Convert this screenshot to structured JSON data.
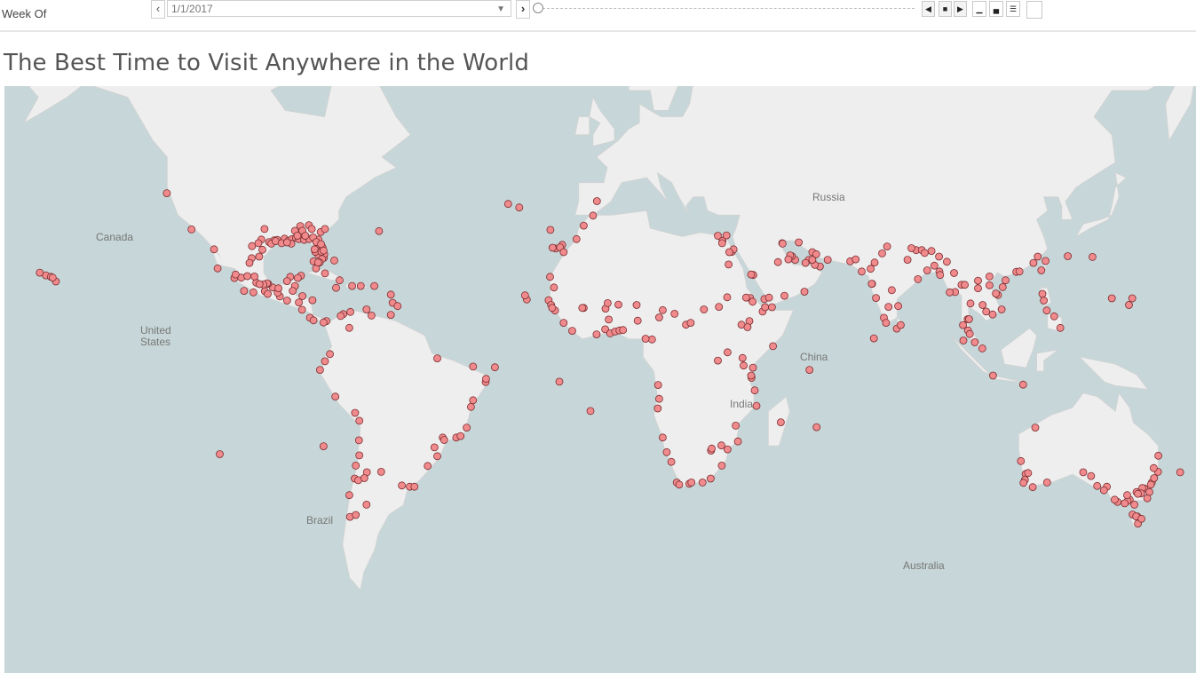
{
  "filter": {
    "label": "Week Of",
    "value": "1/1/2017",
    "prev_icon": "chevron-left-icon",
    "next_icon": "chevron-right-icon",
    "slider_position": 0
  },
  "title": "The Best Time to Visit Anywhere in the World",
  "map": {
    "ocean_color": "#c7d6d8",
    "land_color": "#eeeeee",
    "marker_color": "#f08a8c",
    "marker_stroke": "#7a2c2f",
    "labels": {
      "canada": "Canada",
      "united_states": [
        "United",
        "States"
      ],
      "brazil": "Brazil",
      "russia": "Russia",
      "china": "China",
      "india": "India",
      "australia": "Australia"
    },
    "points": [
      [
        -124.1,
        40.8
      ],
      [
        -117.2,
        32.7
      ],
      [
        -110.9,
        27.9
      ],
      [
        -109.9,
        23.1
      ],
      [
        -105.2,
        20.6
      ],
      [
        -99.9,
        16.8
      ],
      [
        -96.7,
        17.1
      ],
      [
        -95.5,
        29.7
      ],
      [
        -97.4,
        27.8
      ],
      [
        -96.8,
        32.8
      ],
      [
        -97.7,
        30.3
      ],
      [
        -98.5,
        29.4
      ],
      [
        -94.1,
        30.1
      ],
      [
        -93.2,
        30.2
      ],
      [
        -91.2,
        30.5
      ],
      [
        -90.1,
        30.0
      ],
      [
        -89.1,
        30.4
      ],
      [
        -88.0,
        30.7
      ],
      [
        -86.8,
        33.5
      ],
      [
        -87.2,
        30.4
      ],
      [
        -85.7,
        30.2
      ],
      [
        -84.3,
        30.4
      ],
      [
        -84.4,
        33.7
      ],
      [
        -82.5,
        27.9
      ],
      [
        -81.8,
        26.6
      ],
      [
        -80.2,
        25.8
      ],
      [
        -81.4,
        28.5
      ],
      [
        -81.7,
        30.3
      ],
      [
        -81.1,
        32.1
      ],
      [
        -79.9,
        32.8
      ],
      [
        -80.1,
        26.7
      ],
      [
        -82.6,
        27.3
      ],
      [
        -80.6,
        28.4
      ],
      [
        -86.6,
        21.2
      ],
      [
        -87.5,
        20.6
      ],
      [
        -88.3,
        18.5
      ],
      [
        -89.6,
        20.9
      ],
      [
        -90.5,
        14.6
      ],
      [
        -87.2,
        14.1
      ],
      [
        -86.3,
        12.1
      ],
      [
        -84.1,
        9.9
      ],
      [
        -79.5,
        9.0
      ],
      [
        -82.4,
        23.1
      ],
      [
        -79.9,
        21.8
      ],
      [
        -75.8,
        20.0
      ],
      [
        -77.3,
        25.1
      ],
      [
        -76.8,
        18.0
      ],
      [
        -72.3,
        18.5
      ],
      [
        -69.9,
        18.5
      ],
      [
        -66.1,
        18.5
      ],
      [
        -68.3,
        12.2
      ],
      [
        -64.8,
        32.3
      ],
      [
        -61.5,
        16.2
      ],
      [
        -61.0,
        14.0
      ],
      [
        -59.6,
        13.1
      ],
      [
        -61.5,
        10.7
      ],
      [
        -74.8,
        10.9
      ],
      [
        -75.5,
        10.4
      ],
      [
        -73.1,
        7.1
      ],
      [
        -66.9,
        10.5
      ],
      [
        -72.8,
        11.5
      ],
      [
        -79.9,
        -2.2
      ],
      [
        -78.5,
        -0.2
      ],
      [
        -81.3,
        -4.6
      ],
      [
        -77.0,
        -12.0
      ],
      [
        -71.5,
        -16.4
      ],
      [
        -70.3,
        -18.5
      ],
      [
        -70.4,
        -23.6
      ],
      [
        -70.3,
        -27.4
      ],
      [
        -71.3,
        -29.9
      ],
      [
        -71.6,
        -33.0
      ],
      [
        -70.6,
        -33.4
      ],
      [
        -73.1,
        -36.8
      ],
      [
        -72.9,
        -41.5
      ],
      [
        -71.3,
        -41.1
      ],
      [
        -68.3,
        -38.9
      ],
      [
        -64.2,
        -31.4
      ],
      [
        -58.4,
        -34.6
      ],
      [
        -56.2,
        -34.9
      ],
      [
        -54.9,
        -34.9
      ],
      [
        -51.2,
        -30.0
      ],
      [
        -48.5,
        -27.6
      ],
      [
        -49.3,
        -25.4
      ],
      [
        -47.0,
        -22.9
      ],
      [
        -46.6,
        -23.5
      ],
      [
        -43.2,
        -22.9
      ],
      [
        -42.0,
        -22.5
      ],
      [
        -40.3,
        -20.3
      ],
      [
        -38.5,
        -13.0
      ],
      [
        -39.1,
        -14.8
      ],
      [
        -35.0,
        -8.0
      ],
      [
        -34.9,
        -7.1
      ],
      [
        -38.5,
        -3.7
      ],
      [
        -80.3,
        -25.1
      ],
      [
        -32.4,
        -3.9
      ],
      [
        -48.5,
        -1.4
      ],
      [
        -109.3,
        -27.1
      ],
      [
        -25.6,
        37.7
      ],
      [
        -28.7,
        38.5
      ],
      [
        -16.9,
        32.6
      ],
      [
        -15.4,
        28.1
      ],
      [
        -13.6,
        29.0
      ],
      [
        -16.3,
        28.3
      ],
      [
        -14.2,
        28.4
      ],
      [
        -17.4,
        14.7
      ],
      [
        -16.7,
        13.4
      ],
      [
        -13.2,
        8.5
      ],
      [
        -15.6,
        11.9
      ],
      [
        -16.4,
        12.6
      ],
      [
        -10.8,
        6.3
      ],
      [
        -7.6,
        12.6
      ],
      [
        -4.0,
        5.3
      ],
      [
        -1.6,
        6.7
      ],
      [
        -0.2,
        5.6
      ],
      [
        1.2,
        6.1
      ],
      [
        2.4,
        6.4
      ],
      [
        3.4,
        6.5
      ],
      [
        7.5,
        9.1
      ],
      [
        -8.0,
        12.6
      ],
      [
        -1.5,
        12.4
      ],
      [
        2.1,
        13.5
      ],
      [
        -23.5,
        14.9
      ],
      [
        -24.0,
        16.0
      ],
      [
        -14.4,
        -7.9
      ],
      [
        -5.7,
        -15.9
      ],
      [
        11.5,
        3.9
      ],
      [
        9.7,
        4.1
      ],
      [
        13.2,
        -8.8
      ],
      [
        13.5,
        -12.6
      ],
      [
        13.1,
        -15.2
      ],
      [
        14.5,
        -22.9
      ],
      [
        15.6,
        -26.6
      ],
      [
        16.9,
        -29.0
      ],
      [
        18.4,
        -33.9
      ],
      [
        19.1,
        -34.4
      ],
      [
        21.9,
        -34.2
      ],
      [
        22.5,
        -33.9
      ],
      [
        25.6,
        -33.9
      ],
      [
        27.9,
        -33.0
      ],
      [
        31.0,
        -29.9
      ],
      [
        30.9,
        -24.9
      ],
      [
        28.0,
        -26.2
      ],
      [
        28.2,
        -25.7
      ],
      [
        32.6,
        -25.9
      ],
      [
        35.5,
        -23.9
      ],
      [
        34.9,
        -19.8
      ],
      [
        40.7,
        -14.5
      ],
      [
        39.3,
        -6.8
      ],
      [
        39.7,
        -4.0
      ],
      [
        39.2,
        -6.2
      ],
      [
        36.8,
        -1.3
      ],
      [
        37.1,
        -3.4
      ],
      [
        32.6,
        0.3
      ],
      [
        29.9,
        -2.0
      ],
      [
        40.2,
        -10.3
      ],
      [
        47.5,
        -18.9
      ],
      [
        57.5,
        -20.2
      ],
      [
        55.5,
        -4.6
      ],
      [
        31.2,
        30.0
      ],
      [
        31.1,
        29.4
      ],
      [
        32.3,
        31.3
      ],
      [
        29.9,
        31.2
      ],
      [
        32.9,
        24.1
      ],
      [
        33.8,
        27.3
      ],
      [
        34.3,
        27.9
      ],
      [
        32.5,
        15.5
      ],
      [
        33.1,
        27.2
      ],
      [
        38.9,
        15.3
      ],
      [
        38.7,
        9.0
      ],
      [
        42.4,
        11.6
      ],
      [
        45.3,
        2.0
      ],
      [
        43.1,
        12.8
      ],
      [
        45.0,
        12.8
      ],
      [
        42.9,
        15.0
      ],
      [
        44.2,
        15.4
      ],
      [
        48.5,
        15.9
      ],
      [
        54.1,
        17.0
      ],
      [
        58.4,
        23.6
      ],
      [
        57.0,
        24.0
      ],
      [
        55.3,
        25.3
      ],
      [
        54.4,
        24.5
      ],
      [
        56.3,
        25.3
      ],
      [
        51.5,
        25.3
      ],
      [
        50.6,
        26.2
      ],
      [
        50.1,
        26.4
      ],
      [
        49.6,
        25.4
      ],
      [
        46.7,
        24.7
      ],
      [
        39.8,
        21.4
      ],
      [
        39.2,
        21.5
      ],
      [
        47.9,
        29.4
      ],
      [
        48.0,
        29.3
      ],
      [
        56.3,
        27.2
      ],
      [
        52.5,
        29.6
      ],
      [
        60.6,
        25.3
      ],
      [
        57.4,
        26.7
      ],
      [
        66.9,
        24.9
      ],
      [
        68.4,
        25.4
      ],
      [
        73.0,
        19.1
      ],
      [
        72.9,
        19.1
      ],
      [
        74.1,
        15.3
      ],
      [
        76.3,
        9.9
      ],
      [
        76.9,
        8.5
      ],
      [
        80.3,
        13.1
      ],
      [
        78.5,
        17.4
      ],
      [
        77.6,
        12.9
      ],
      [
        79.9,
        6.9
      ],
      [
        81.0,
        7.9
      ],
      [
        73.5,
        4.2
      ],
      [
        72.6,
        23.0
      ],
      [
        75.8,
        26.9
      ],
      [
        77.2,
        28.6
      ],
      [
        73.7,
        24.6
      ],
      [
        70.1,
        22.3
      ],
      [
        82.9,
        25.3
      ],
      [
        85.8,
        20.3
      ],
      [
        88.4,
        22.6
      ],
      [
        85.3,
        27.7
      ],
      [
        84.0,
        28.2
      ],
      [
        89.6,
        27.5
      ],
      [
        90.4,
        23.8
      ],
      [
        91.8,
        22.3
      ],
      [
        92.0,
        21.4
      ],
      [
        86.9,
        27.7
      ],
      [
        87.7,
        27.0
      ],
      [
        91.7,
        26.1
      ],
      [
        93.9,
        24.8
      ],
      [
        96.2,
        16.9
      ],
      [
        95.9,
        21.9
      ],
      [
        94.7,
        16.8
      ],
      [
        98.0,
        18.8
      ],
      [
        100.5,
        13.8
      ],
      [
        98.4,
        7.9
      ],
      [
        99.8,
        6.4
      ],
      [
        100.3,
        5.4
      ],
      [
        101.7,
        3.1
      ],
      [
        103.8,
        1.4
      ],
      [
        104.9,
        11.6
      ],
      [
        103.9,
        13.4
      ],
      [
        106.7,
        10.8
      ],
      [
        108.2,
        16.1
      ],
      [
        105.8,
        21.0
      ],
      [
        109.2,
        12.2
      ],
      [
        102.6,
        17.9
      ],
      [
        102.6,
        19.9
      ],
      [
        98.9,
        18.8
      ],
      [
        99.7,
        9.5
      ],
      [
        100.1,
        9.5
      ],
      [
        98.5,
        3.6
      ],
      [
        107.6,
        16.5
      ],
      [
        105.8,
        18.7
      ],
      [
        113.3,
        22.2
      ],
      [
        114.2,
        22.3
      ],
      [
        120.3,
        22.6
      ],
      [
        121.5,
        25.0
      ],
      [
        119.3,
        26.1
      ],
      [
        110.3,
        20.0
      ],
      [
        109.5,
        18.2
      ],
      [
        118.1,
        24.5
      ],
      [
        121.0,
        14.6
      ],
      [
        123.9,
        10.3
      ],
      [
        120.6,
        16.4
      ],
      [
        121.8,
        11.9
      ],
      [
        125.6,
        7.1
      ],
      [
        127.7,
        26.2
      ],
      [
        134.6,
        26.0
      ],
      [
        115.2,
        -8.7
      ],
      [
        106.8,
        -6.2
      ],
      [
        140.0,
        15.2
      ],
      [
        144.8,
        13.4
      ],
      [
        145.7,
        15.2
      ],
      [
        166.5,
        19.3
      ],
      [
        -157.9,
        21.3
      ],
      [
        -155.1,
        19.7
      ],
      [
        -156.5,
        20.9
      ],
      [
        -159.6,
        22.0
      ],
      [
        -156.0,
        20.7
      ],
      [
        178.4,
        -18.1
      ],
      [
        166.5,
        -22.3
      ],
      [
        153.0,
        -27.5
      ],
      [
        151.2,
        -33.9
      ],
      [
        150.9,
        -34.4
      ],
      [
        149.1,
        -35.3
      ],
      [
        147.3,
        -42.9
      ],
      [
        145.0,
        -37.8
      ],
      [
        144.4,
        -38.1
      ],
      [
        147.1,
        -41.4
      ],
      [
        146.3,
        -38.9
      ],
      [
        143.6,
        -38.6
      ],
      [
        141.6,
        -38.3
      ],
      [
        140.8,
        -37.8
      ],
      [
        138.6,
        -34.9
      ],
      [
        137.8,
        -35.7
      ],
      [
        135.9,
        -34.7
      ],
      [
        151.8,
        -32.9
      ],
      [
        152.9,
        -31.4
      ],
      [
        148.5,
        -35.2
      ],
      [
        150.5,
        -36.1
      ],
      [
        146.9,
        -36.1
      ],
      [
        148.2,
        -36.4
      ],
      [
        149.9,
        -37.5
      ],
      [
        145.8,
        -41.0
      ],
      [
        146.8,
        -41.4
      ],
      [
        148.3,
        -41.9
      ],
      [
        147.3,
        -36.5
      ],
      [
        144.3,
        -36.8
      ],
      [
        151.7,
        -30.5
      ],
      [
        118.6,
        -20.3
      ],
      [
        115.9,
        -31.9
      ],
      [
        115.7,
        -33.3
      ],
      [
        115.3,
        -34.0
      ],
      [
        117.9,
        -35.0
      ],
      [
        121.9,
        -33.9
      ],
      [
        116.6,
        -31.7
      ],
      [
        114.6,
        -28.8
      ],
      [
        132.0,
        -31.5
      ],
      [
        134.2,
        -32.4
      ],
      [
        174.8,
        -36.8
      ],
      [
        176.2,
        -37.7
      ],
      [
        174.1,
        -39.1
      ],
      [
        173.3,
        -41.3
      ],
      [
        176.9,
        -39.5
      ],
      [
        172.6,
        -43.5
      ],
      [
        172.0,
        -42.0
      ],
      [
        170.5,
        -45.9
      ],
      [
        168.6,
        -46.4
      ],
      [
        159.1,
        -31.5
      ],
      [
        167.9,
        -29.0
      ],
      [
        -68.2,
        -31.5
      ],
      [
        -68.9,
        -32.9
      ],
      [
        -17.0,
        20.9
      ],
      [
        -13.2,
        27.2
      ],
      [
        -15.9,
        18.1
      ],
      [
        -9.6,
        30.4
      ],
      [
        -7.6,
        33.6
      ],
      [
        -5.0,
        35.9
      ],
      [
        -3.9,
        39.1
      ],
      [
        -0.9,
        13.9
      ],
      [
        7.2,
        13.4
      ],
      [
        13.5,
        10.0
      ],
      [
        17.8,
        11.0
      ],
      [
        14.5,
        12.0
      ],
      [
        21.0,
        8.0
      ],
      [
        22.3,
        8.5
      ],
      [
        26.0,
        12.2
      ],
      [
        30.2,
        12.9
      ],
      [
        36.5,
        8.0
      ],
      [
        38.2,
        7.3
      ],
      [
        39.6,
        14.3
      ],
      [
        37.8,
        15.4
      ],
      [
        -0.6,
        9.4
      ],
      [
        -92.5,
        15.7
      ],
      [
        -93.1,
        16.7
      ],
      [
        -94.5,
        18.1
      ],
      [
        -95.9,
        16.4
      ],
      [
        -102.5,
        17.2
      ],
      [
        -103.3,
        20.7
      ],
      [
        -100.4,
        25.7
      ],
      [
        -101.0,
        24.5
      ],
      [
        -99.1,
        19.4
      ],
      [
        -92.9,
        17.9
      ],
      [
        -90.5,
        19.8
      ],
      [
        -88.9,
        17.2
      ],
      [
        -86.2,
        15.8
      ],
      [
        -83.4,
        14.7
      ],
      [
        -83.1,
        9.2
      ],
      [
        -80.3,
        8.6
      ],
      [
        -95.8,
        19.1
      ],
      [
        -96.1,
        19.2
      ],
      [
        -97.1,
        18.9
      ],
      [
        -98.2,
        19.0
      ],
      [
        -99.6,
        21.0
      ],
      [
        -101.6,
        21.1
      ],
      [
        -98.3,
        26.1
      ],
      [
        -100.3,
        28.7
      ],
      [
        -104.9,
        21.5
      ],
      [
        -94.9,
        29.3
      ],
      [
        -93.7,
        29.9
      ],
      [
        -92.0,
        29.4
      ],
      [
        -89.3,
        29.3
      ],
      [
        -90.5,
        29.6
      ],
      [
        -88.3,
        32.4
      ],
      [
        -87.6,
        31.2
      ],
      [
        -86.2,
        32.4
      ],
      [
        -85.4,
        31.2
      ],
      [
        -83.2,
        30.8
      ],
      [
        -83.6,
        32.8
      ],
      [
        -82.3,
        29.7
      ],
      [
        -81.0,
        29.2
      ],
      [
        -80.7,
        25.5
      ],
      [
        -81.4,
        24.6
      ],
      [
        -82.8,
        27.9
      ],
      [
        -80.9,
        27.3
      ],
      [
        -83.1,
        24.9
      ],
      [
        -80.3,
        27.6
      ],
      [
        -81.8,
        24.6
      ]
    ]
  }
}
